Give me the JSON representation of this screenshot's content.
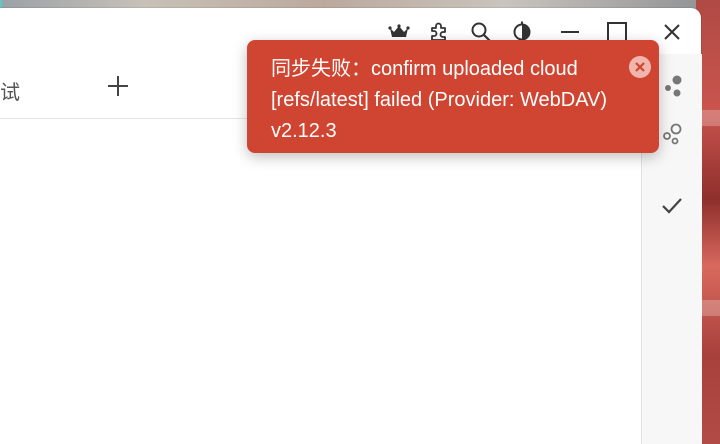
{
  "titlebar": {
    "icons": [
      "crown-icon",
      "puzzle-icon",
      "search-icon",
      "theme-icon",
      "minimize-icon",
      "maximize-icon",
      "close-icon"
    ]
  },
  "tab": {
    "label": "测试"
  },
  "toast": {
    "message": "同步失败：confirm uploaded cloud [refs/latest] failed (Provider: WebDAV) v2.12.3",
    "color": "#d04531"
  },
  "side_panel": {
    "icons": [
      "dots-icon",
      "graph-icon",
      "check-icon"
    ]
  }
}
